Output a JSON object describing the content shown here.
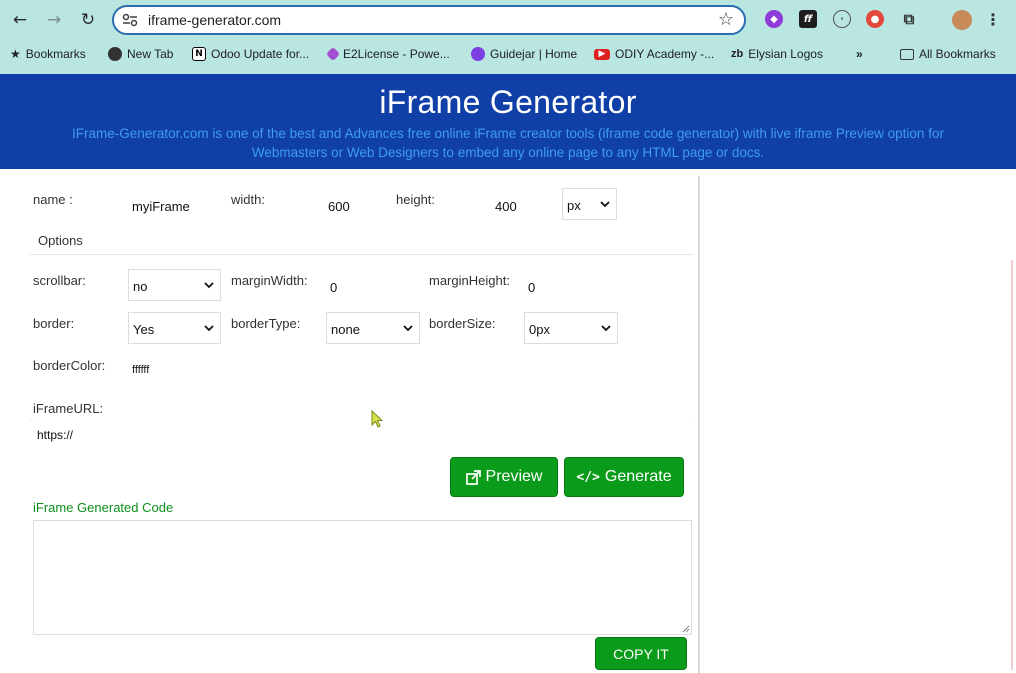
{
  "browser": {
    "url": "iframe-generator.com",
    "bookmarks": [
      {
        "label": "Bookmarks",
        "icon": "star-icon"
      },
      {
        "label": "New Tab",
        "icon": "globe-icon"
      },
      {
        "label": "Odoo Update for...",
        "icon": "notion-icon",
        "glyph": "N"
      },
      {
        "label": "E2License - Powe...",
        "icon": "diamond-icon"
      },
      {
        "label": "Guidejar | Home",
        "icon": "guidejar-icon"
      },
      {
        "label": "ODIY Academy -...",
        "icon": "youtube-icon"
      },
      {
        "label": "Elysian Logos",
        "icon": "zb-icon",
        "glyph": "zb"
      },
      {
        "label": "»",
        "icon": "more-icon"
      },
      {
        "label": "All Bookmarks",
        "icon": "folder-icon"
      }
    ]
  },
  "header": {
    "title": "iFrame Generator",
    "subtitle_line1": "IFrame-Generator.com is one of the best and Advances free online iFrame creator tools (iframe code generator) with live iframe Preview option for",
    "subtitle_line2": "Webmasters or Web Designers to embed any online page to any HTML page or docs."
  },
  "form": {
    "name_label": "name :",
    "name_value": "myiFrame",
    "width_label": "width:",
    "width_value": "600",
    "height_label": "height:",
    "height_value": "400",
    "unit_value": "px",
    "options_label": "Options",
    "scrollbar_label": "scrollbar:",
    "scrollbar_value": "no",
    "marginwidth_label": "marginWidth:",
    "marginwidth_value": "0",
    "marginheight_label": "marginHeight:",
    "marginheight_value": "0",
    "border_label": "border:",
    "border_value": "Yes",
    "bordertype_label": "borderType:",
    "bordertype_value": "none",
    "bordersize_label": "borderSize:",
    "bordersize_value": "0px",
    "bordercolor_label": "borderColor:",
    "bordercolor_value": "ffffff",
    "url_label": "iFrameURL:",
    "url_value": "https://"
  },
  "actions": {
    "preview_label": "Preview",
    "generate_label": "Generate",
    "generated_code_label": "iFrame Generated Code",
    "copy_label": "COPY IT"
  },
  "colors": {
    "chrome": "#b9e6e0",
    "banner": "#0f3fa7",
    "button_green": "#0b9b1b"
  }
}
